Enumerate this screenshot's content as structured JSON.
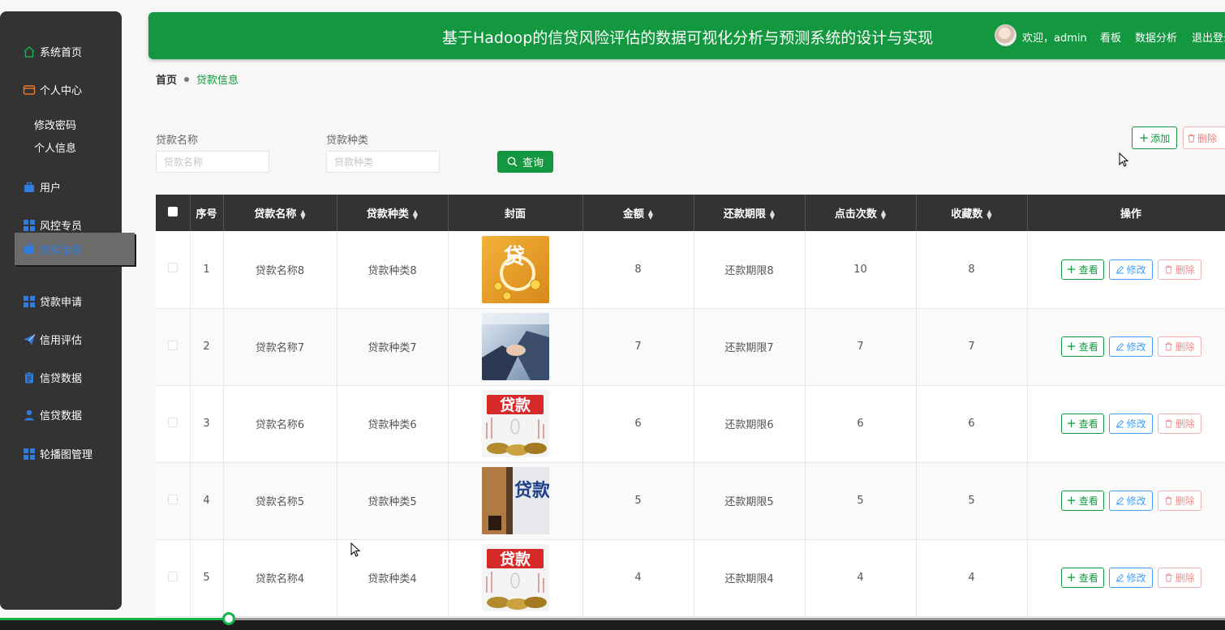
{
  "sidebar": {
    "items": [
      {
        "label": "系统首页",
        "icon": "home-icon"
      },
      {
        "label": "个人中心",
        "icon": "wallet-icon"
      },
      {
        "label": "用户",
        "icon": "briefcase-icon"
      },
      {
        "label": "风控专员",
        "icon": "grid-icon"
      },
      {
        "label": "贷款信息",
        "icon": "briefcase-icon"
      },
      {
        "label": "贷款申请",
        "icon": "grid-icon"
      },
      {
        "label": "信用评估",
        "icon": "send-icon"
      },
      {
        "label": "信贷数据",
        "icon": "clipboard-icon"
      },
      {
        "label": "信贷数据",
        "icon": "user-icon"
      },
      {
        "label": "轮播图管理",
        "icon": "grid-icon"
      }
    ],
    "sub_items": [
      "修改密码",
      "个人信息"
    ],
    "active_label": "贷款信息"
  },
  "header": {
    "title": "基于Hadoop的信贷风险评估的数据可视化分析与预测系统的设计与实现",
    "welcome": "欢迎，admin",
    "links": [
      "看板",
      "数据分析",
      "退出登录"
    ]
  },
  "breadcrumb": {
    "home": "首页",
    "current": "贷款信息"
  },
  "search": {
    "fields": [
      {
        "label": "贷款名称",
        "placeholder": "贷款名称"
      },
      {
        "label": "贷款种类",
        "placeholder": "贷款种类"
      }
    ],
    "button_label": "查询"
  },
  "toolbar": {
    "add_label": "添加",
    "delete_label": "删除"
  },
  "table": {
    "columns": [
      "序号",
      "贷款名称",
      "贷款种类",
      "封面",
      "金额",
      "还款期限",
      "点击次数",
      "收藏数",
      "操作"
    ],
    "rows": [
      {
        "index": "1",
        "name": "贷款名称8",
        "type": "贷款种类8",
        "cover": "贷",
        "amount": "8",
        "term": "还款期限8",
        "clicks": "10",
        "favorites": "8"
      },
      {
        "index": "2",
        "name": "贷款名称7",
        "type": "贷款种类7",
        "cover": "",
        "amount": "7",
        "term": "还款期限7",
        "clicks": "7",
        "favorites": "7"
      },
      {
        "index": "3",
        "name": "贷款名称6",
        "type": "贷款种类6",
        "cover": "贷款",
        "amount": "6",
        "term": "还款期限6",
        "clicks": "6",
        "favorites": "6"
      },
      {
        "index": "4",
        "name": "贷款名称5",
        "type": "贷款种类5",
        "cover": "贷款",
        "amount": "5",
        "term": "还款期限5",
        "clicks": "5",
        "favorites": "5"
      },
      {
        "index": "5",
        "name": "贷款名称4",
        "type": "贷款种类4",
        "cover": "贷款",
        "amount": "4",
        "term": "还款期限4",
        "clicks": "4",
        "favorites": "4"
      }
    ],
    "actions": {
      "view": "查看",
      "edit": "修改",
      "delete": "删除"
    }
  },
  "video_progress": 0.187,
  "colors": {
    "primary": "#13983f",
    "sidebar": "#333333",
    "active_text": "#2f7de1",
    "edit": "#409eff",
    "danger": "#f28b8b"
  }
}
